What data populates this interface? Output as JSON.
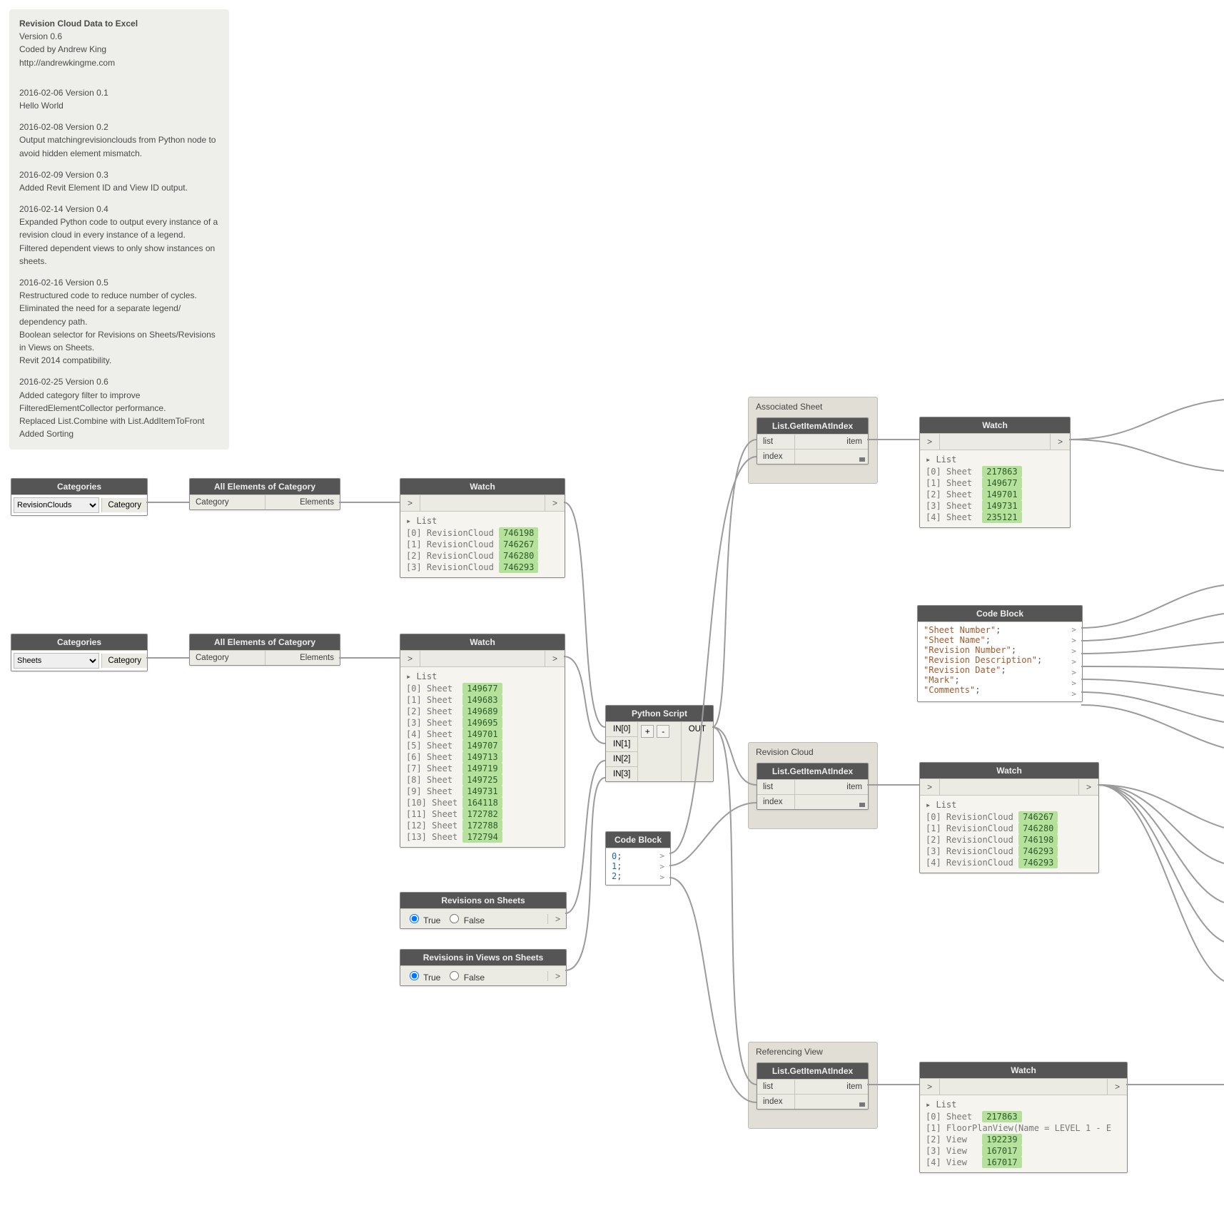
{
  "note": {
    "title": "Revision Cloud Data to Excel",
    "version": "Version 0.6",
    "author": "Coded by Andrew King",
    "url": "http://andrewkingme.com",
    "changelog": [
      {
        "h": "2016-02-06 Version 0.1",
        "b": [
          "Hello World"
        ]
      },
      {
        "h": "2016-02-08 Version 0.2",
        "b": [
          "Output matchingrevisionclouds from Python node to",
          "avoid hidden element mismatch."
        ]
      },
      {
        "h": "2016-02-09 Version 0.3",
        "b": [
          "Added Revit Element ID and View ID output."
        ]
      },
      {
        "h": "2016-02-14 Version 0.4",
        "b": [
          "Expanded Python code to output every instance of a",
          "revision cloud in every instance of a legend.",
          "Filtered dependent views to only show instances on",
          "sheets."
        ]
      },
      {
        "h": "2016-02-16 Version 0.5",
        "b": [
          "Restructured code to reduce number of cycles.",
          "Eliminated the need for a separate legend/",
          "dependency path.",
          "Boolean selector for Revisions on Sheets/Revisions",
          "in Views on Sheets.",
          "Revit 2014 compatibility."
        ]
      },
      {
        "h": "2016-02-25 Version 0.6",
        "b": [
          "Added category filter to improve",
          "FilteredElementCollector performance.",
          "Replaced List.Combine with List.AddItemToFront",
          "Added Sorting"
        ]
      }
    ]
  },
  "labels": {
    "categories": "Categories",
    "category_out": "Category",
    "all_elements": "All Elements of Category",
    "elements_out": "Elements",
    "watch": "Watch",
    "list": "List",
    "code_block": "Code Block",
    "python": "Python Script",
    "out": "OUT",
    "item": "item",
    "list_port": "list",
    "index_port": "index",
    "getitem": "List.GetItemAtIndex",
    "rev_on_sheets": "Revisions on Sheets",
    "rev_in_views": "Revisions in Views on Sheets",
    "true": "True",
    "false": "False"
  },
  "category1": {
    "selected": "RevisionClouds"
  },
  "category2": {
    "selected": "Sheets"
  },
  "watch_revclouds": {
    "items": [
      {
        "i": "[0]",
        "t": "RevisionCloud",
        "v": "746198"
      },
      {
        "i": "[1]",
        "t": "RevisionCloud",
        "v": "746267"
      },
      {
        "i": "[2]",
        "t": "RevisionCloud",
        "v": "746280"
      },
      {
        "i": "[3]",
        "t": "RevisionCloud",
        "v": "746293"
      }
    ]
  },
  "watch_sheets": {
    "items": [
      {
        "i": "[0]",
        "t": "Sheet",
        "v": "149677"
      },
      {
        "i": "[1]",
        "t": "Sheet",
        "v": "149683"
      },
      {
        "i": "[2]",
        "t": "Sheet",
        "v": "149689"
      },
      {
        "i": "[3]",
        "t": "Sheet",
        "v": "149695"
      },
      {
        "i": "[4]",
        "t": "Sheet",
        "v": "149701"
      },
      {
        "i": "[5]",
        "t": "Sheet",
        "v": "149707"
      },
      {
        "i": "[6]",
        "t": "Sheet",
        "v": "149713"
      },
      {
        "i": "[7]",
        "t": "Sheet",
        "v": "149719"
      },
      {
        "i": "[8]",
        "t": "Sheet",
        "v": "149725"
      },
      {
        "i": "[9]",
        "t": "Sheet",
        "v": "149731"
      },
      {
        "i": "[10]",
        "t": "Sheet",
        "v": "164118"
      },
      {
        "i": "[11]",
        "t": "Sheet",
        "v": "172782"
      },
      {
        "i": "[12]",
        "t": "Sheet",
        "v": "172788"
      },
      {
        "i": "[13]",
        "t": "Sheet",
        "v": "172794"
      }
    ]
  },
  "py_ins": [
    "IN[0]",
    "IN[1]",
    "IN[2]",
    "IN[3]"
  ],
  "cb_index": {
    "lines": [
      "0;",
      "1;",
      "2;"
    ]
  },
  "groups": {
    "assoc_sheet": "Associated Sheet",
    "rev_cloud": "Revision Cloud",
    "ref_view": "Referencing View"
  },
  "watch_assoc": {
    "items": [
      {
        "i": "[0]",
        "t": "Sheet",
        "v": "217863"
      },
      {
        "i": "[1]",
        "t": "Sheet",
        "v": "149677"
      },
      {
        "i": "[2]",
        "t": "Sheet",
        "v": "149701"
      },
      {
        "i": "[3]",
        "t": "Sheet",
        "v": "149731"
      },
      {
        "i": "[4]",
        "t": "Sheet",
        "v": "235121"
      }
    ]
  },
  "cb_labels": {
    "lines": [
      "\"Sheet Number\";",
      "\"Sheet Name\";",
      "\"Revision Number\";",
      "\"Revision Description\";",
      "\"Revision Date\";",
      "\"Mark\";",
      "\"Comments\";"
    ]
  },
  "watch_rc": {
    "items": [
      {
        "i": "[0]",
        "t": "RevisionCloud",
        "v": "746267"
      },
      {
        "i": "[1]",
        "t": "RevisionCloud",
        "v": "746280"
      },
      {
        "i": "[2]",
        "t": "RevisionCloud",
        "v": "746198"
      },
      {
        "i": "[3]",
        "t": "RevisionCloud",
        "v": "746293"
      },
      {
        "i": "[4]",
        "t": "RevisionCloud",
        "v": "746293"
      }
    ]
  },
  "watch_ref": {
    "items": [
      {
        "i": "[0]",
        "t": "Sheet",
        "v": "217863",
        "hl": true
      },
      {
        "i": "[1]",
        "t": "FloorPlanView(Name = LEVEL 1 - E",
        "v": "",
        "hl": false
      },
      {
        "i": "[2]",
        "t": "View",
        "v": "192239",
        "hl": true
      },
      {
        "i": "[3]",
        "t": "View",
        "v": "167017",
        "hl": true
      },
      {
        "i": "[4]",
        "t": "View",
        "v": "167017",
        "hl": true
      }
    ]
  }
}
